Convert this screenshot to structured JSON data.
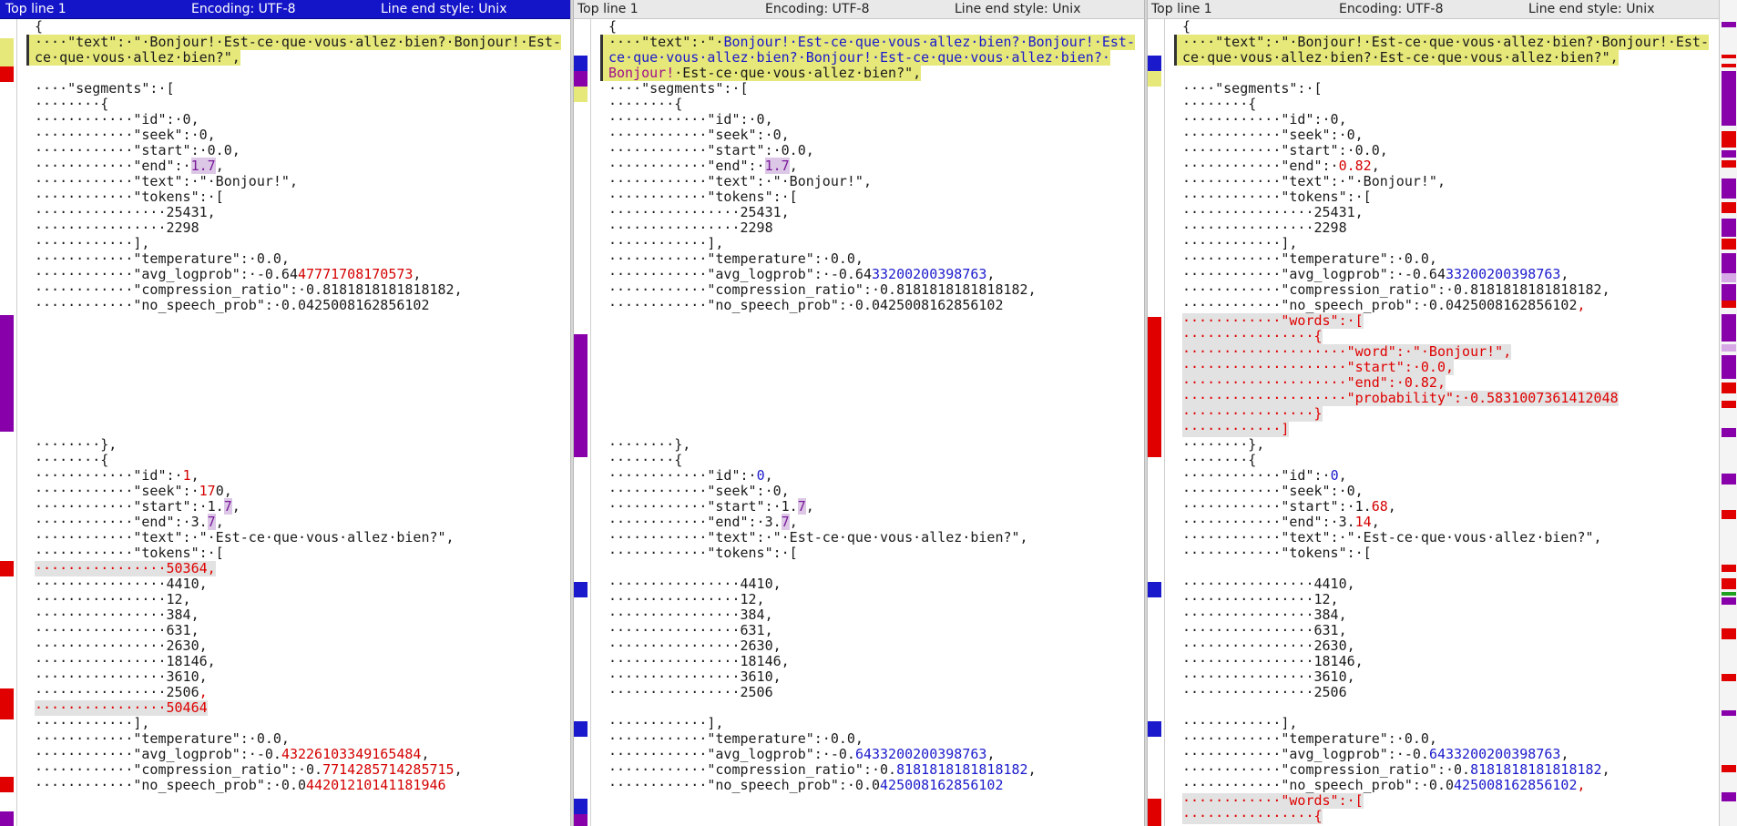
{
  "panes": [
    {
      "top_line": "Top line 1",
      "encoding": "Encoding: UTF-8",
      "line_end": "Line end style: Unix",
      "active": true
    },
    {
      "top_line": "Top line 1",
      "encoding": "Encoding: UTF-8",
      "line_end": "Line end style: Unix",
      "active": false
    },
    {
      "top_line": "Top line 1",
      "encoding": "Encoding: UTF-8",
      "line_end": "Line end style: Unix",
      "active": false
    }
  ],
  "colors": {
    "active_header": "#1414c8",
    "changed_yellow": "#e6e87a",
    "diff_red": "#e00000",
    "moved_purple": "#8800aa",
    "diff_blue": "#1a1acc"
  },
  "file1": {
    "l1": "{",
    "l2a": "····\"text\":·\"·Bonjour!·Est-ce·que·vous·allez·bien?·Bonjour!·Est-",
    "l2b": "ce·que·vous·allez·bien?\",",
    "l4": "····\"segments\":·[",
    "l5": "········{",
    "l6": "············\"id\":·0,",
    "l7": "············\"seek\":·0,",
    "l8": "············\"start\":·0.0,",
    "l9_pre": "············\"end\":·",
    "l9_val": "1.7",
    "l9_post": ",",
    "l10": "············\"text\":·\"·Bonjour!\",",
    "l11": "············\"tokens\":·[",
    "l12": "················25431,",
    "l13": "················2298",
    "l14": "············],",
    "l15": "············\"temperature\":·0.0,",
    "l16_pre": "············\"avg_logprob\":·-0.64",
    "l16_val": "47771708170573",
    "l16_post": ",",
    "l17": "············\"compression_ratio\":·0.8181818181818182,",
    "l18": "············\"no_speech_prob\":·0.0425008162856102",
    "s1": "········},",
    "s2": "········{",
    "s3_pre": "············\"id\":·",
    "s3_val": "1",
    "s3_post": ",",
    "s4_pre": "············\"seek\":·",
    "s4_val": "17",
    "s4_post": "0,",
    "s5_pre": "············\"start\":·1.",
    "s5_val": "7",
    "s5_post": ",",
    "s6_pre": "············\"end\":·3.",
    "s6_val": "7",
    "s6_post": ",",
    "s7": "············\"text\":·\"·Est-ce·que·vous·allez·bien?\",",
    "s8": "············\"tokens\":·[",
    "s9": "················50364,",
    "s10": "················4410,",
    "s11": "················12,",
    "s12": "················384,",
    "s13": "················631,",
    "s14": "················2630,",
    "s15": "················18146,",
    "s16": "················3610,",
    "s17": "················2506",
    "s17c": ",",
    "s18": "················50464",
    "s19": "············],",
    "s20": "············\"temperature\":·0.0,",
    "s21_pre": "············\"avg_logprob\":·-0.",
    "s21_val": "43226103349165484",
    "s21_post": ",",
    "s22_pre": "············\"compression_ratio\":·0.",
    "s22_val": "7714285714285715",
    "s22_post": ",",
    "s23_pre": "············\"no_speech_prob\":·0.0",
    "s23_val": "44201210141181946"
  },
  "file2": {
    "l1": "{",
    "l2a_pre": "····\"text\":·\"·",
    "l2a_val": "Bonjour!·Est-ce·que·vous·allez·bien?·Bonjour!·Est-",
    "l2b_val": "ce·que·vous·allez·bien?·Bonjour!·Est-ce·que·vous·allez·bien?·",
    "l2c_a": "Bonjour!",
    "l2c_b": "·Est-ce·que·vous·allez·bien?\",",
    "l4": "····\"segments\":·[",
    "l5": "········{",
    "l6": "············\"id\":·0,",
    "l7": "············\"seek\":·0,",
    "l8": "············\"start\":·0.0,",
    "l9_pre": "············\"end\":·",
    "l9_val": "1.7",
    "l9_post": ",",
    "l10": "············\"text\":·\"·Bonjour!\",",
    "l11": "············\"tokens\":·[",
    "l12": "················25431,",
    "l13": "················2298",
    "l14": "············],",
    "l15": "············\"temperature\":·0.0,",
    "l16_pre": "············\"avg_logprob\":·-0.64",
    "l16_val": "33200200398763",
    "l16_post": ",",
    "l17": "············\"compression_ratio\":·0.8181818181818182,",
    "l18": "············\"no_speech_prob\":·0.0425008162856102",
    "s1": "········},",
    "s2": "········{",
    "s3_pre": "············\"id\":·",
    "s3_val": "0",
    "s3_post": ",",
    "s4": "············\"seek\":·0,",
    "s5_pre": "············\"start\":·1.",
    "s5_val": "7",
    "s5_post": ",",
    "s6_pre": "············\"end\":·3.",
    "s6_val": "7",
    "s6_post": ",",
    "s7": "············\"text\":·\"·Est-ce·que·vous·allez·bien?\",",
    "s8": "············\"tokens\":·[",
    "s10": "················4410,",
    "s11": "················12,",
    "s12": "················384,",
    "s13": "················631,",
    "s14": "················2630,",
    "s15": "················18146,",
    "s16": "················3610,",
    "s17": "················2506",
    "s19": "············],",
    "s20": "············\"temperature\":·0.0,",
    "s21_pre": "············\"avg_logprob\":·-0.",
    "s21_val": "6433200200398763",
    "s21_post": ",",
    "s22_pre": "············\"compression_ratio\":·0.",
    "s22_val": "8181818181818182",
    "s22_post": ",",
    "s23_pre": "············\"no_speech_prob\":·0.0",
    "s23_val": "425008162856102"
  },
  "file3": {
    "l1": "{",
    "l2a": "····\"text\":·\"·Bonjour!·Est-ce·que·vous·allez·bien?·Bonjour!·Est-",
    "l2b": "ce·que·vous·allez·bien?·Est-ce·que·vous·allez·bien?\",",
    "l4": "····\"segments\":·[",
    "l5": "········{",
    "l6": "············\"id\":·0,",
    "l7": "············\"seek\":·0,",
    "l8": "············\"start\":·0.0,",
    "l9_pre": "············\"end\":·",
    "l9_val": "0.82",
    "l9_post": ",",
    "l10": "············\"text\":·\"·Bonjour!\",",
    "l11": "············\"tokens\":·[",
    "l12": "················25431,",
    "l13": "················2298",
    "l14": "············],",
    "l15": "············\"temperature\":·0.0,",
    "l16_pre": "············\"avg_logprob\":·-0.64",
    "l16_val": "33200200398763",
    "l16_post": ",",
    "l17": "············\"compression_ratio\":·0.8181818181818182,",
    "l18": "············\"no_speech_prob\":·0.0425008162856102",
    "l18c": ",",
    "w1": "············\"words\":·[",
    "w2": "················{",
    "w3": "····················\"word\":·\"·Bonjour!\",",
    "w4": "····················\"start\":·0.0,",
    "w5": "····················\"end\":·0.82,",
    "w6": "····················\"probability\":·0.5831007361412048",
    "w7": "················}",
    "w8": "············]",
    "s1": "········},",
    "s2": "········{",
    "s3_pre": "············\"id\":·",
    "s3_val": "0",
    "s3_post": ",",
    "s4": "············\"seek\":·0,",
    "s5_pre": "············\"start\":·1.",
    "s5_val": "68",
    "s5_post": ",",
    "s6_pre": "············\"end\":·3.",
    "s6_val": "14",
    "s6_post": ",",
    "s7": "············\"text\":·\"·Est-ce·que·vous·allez·bien?\",",
    "s8": "············\"tokens\":·[",
    "s10": "················4410,",
    "s11": "················12,",
    "s12": "················384,",
    "s13": "················631,",
    "s14": "················2630,",
    "s15": "················18146,",
    "s16": "················3610,",
    "s17": "················2506",
    "s19": "············],",
    "s20": "············\"temperature\":·0.0,",
    "s21_pre": "············\"avg_logprob\":·-0.",
    "s21_val": "6433200200398763",
    "s21_post": ",",
    "s22_pre": "············\"compression_ratio\":·0.",
    "s22_val": "8181818181818182",
    "s22_post": ",",
    "s23_pre": "············\"no_speech_prob\":·0.0",
    "s23_val": "425008162856102",
    "s23c": ",",
    "w9": "············\"words\":·[",
    "w10": "················{"
  }
}
